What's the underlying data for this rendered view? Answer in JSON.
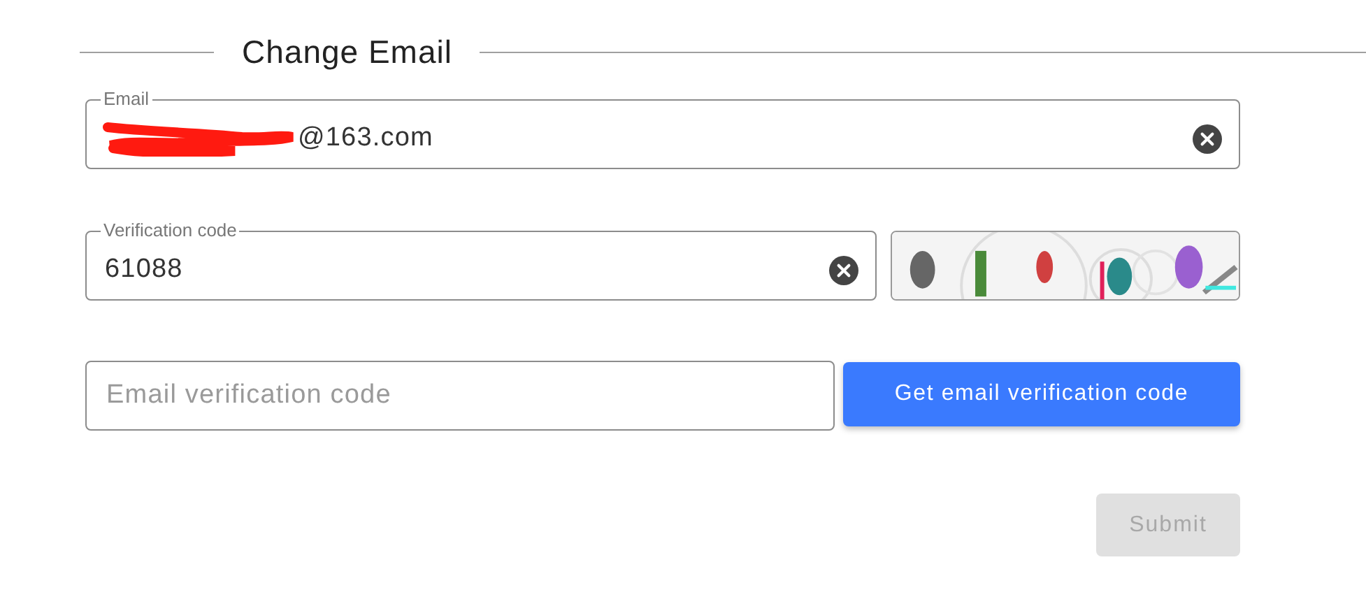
{
  "section": {
    "title": "Change Email"
  },
  "email_field": {
    "label": "Email",
    "value": "@163.com",
    "redacted": true,
    "clearable": true
  },
  "verification_field": {
    "label": "Verification code",
    "value": "61088",
    "clearable": true
  },
  "email_code_field": {
    "placeholder": "Email verification code"
  },
  "get_code_button": {
    "label": "Get email verification code"
  },
  "submit_button": {
    "label": "Submit",
    "disabled": true
  }
}
